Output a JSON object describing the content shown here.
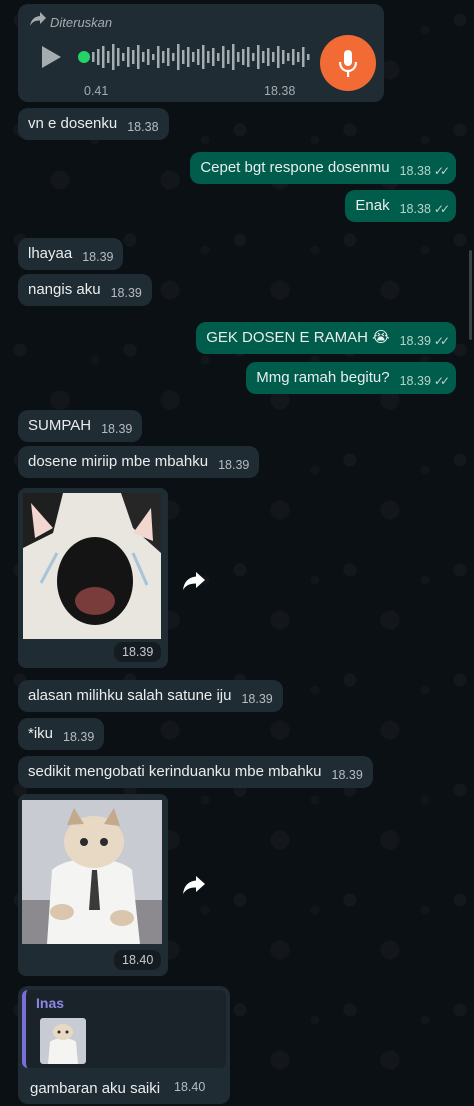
{
  "voice_note": {
    "forwarded_label": "Diteruskan",
    "duration": "0.41",
    "time": "18.38"
  },
  "messages": [
    {
      "text": "vn e dosenku",
      "time": "18.38"
    },
    {
      "text": "Cepet bgt respone dosenmu",
      "time": "18.38",
      "ticks": "✓✓"
    },
    {
      "text": "Enak",
      "time": "18.38",
      "ticks": "✓✓"
    },
    {
      "text": "lhayaa",
      "time": "18.39"
    },
    {
      "text": "nangis aku",
      "time": "18.39"
    },
    {
      "text": "GEK DOSEN E RAMAH 😭",
      "time": "18.39",
      "ticks": "✓✓"
    },
    {
      "text": "Mmg ramah begitu?",
      "time": "18.39",
      "ticks": "✓✓"
    },
    {
      "text": "SUMPAH",
      "time": "18.39"
    },
    {
      "text": "dosene miriip mbe mbahku",
      "time": "18.39"
    },
    {
      "text": "alasan milihku salah satune iju",
      "time": "18.39"
    },
    {
      "text": "*iku",
      "time": "18.39"
    },
    {
      "text": "sedikit mengobati kerinduanku mbe mbahku",
      "time": "18.39"
    }
  ],
  "images": [
    {
      "alt": "crying cat photo",
      "time": "18.39"
    },
    {
      "alt": "cat in robe photo",
      "time": "18.40"
    }
  ],
  "reply_message": {
    "quoted_name": "Inas",
    "text": "gambaran aku saiki",
    "time": "18.40"
  },
  "colors": {
    "incoming_bubble": "#202c33",
    "outgoing_bubble": "#005c4b",
    "mic_button": "#f26b35",
    "quote_bar": "#7b6fd6"
  }
}
